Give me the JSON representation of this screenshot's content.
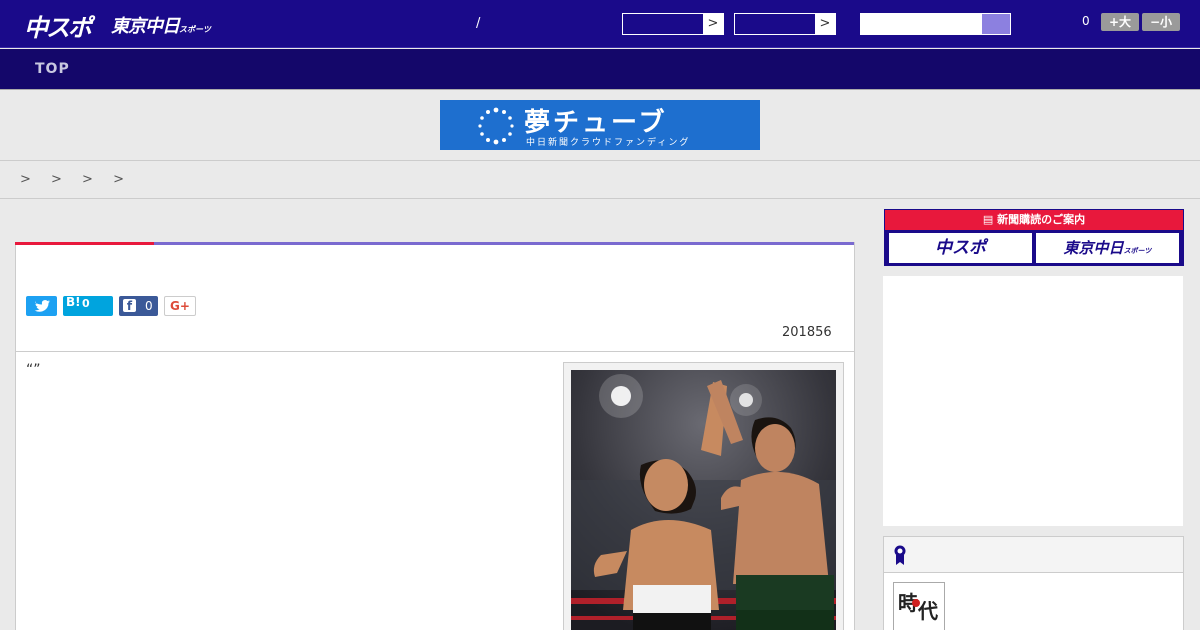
{
  "header": {
    "logo_main": "中スポ",
    "logo_sub": "東京中日",
    "logo_sub_small": "スポーツ",
    "date_separator": "/",
    "font_size_value": "0",
    "font_larger_label": "+大",
    "font_smaller_label": "−小",
    "select_arrow": ">"
  },
  "nav": {
    "items": [
      "TOP"
    ]
  },
  "banner": {
    "title": "夢チューブ",
    "subtitle": "中日新聞クラウドファンディング"
  },
  "breadcrumb": {
    "separators": "> > > >"
  },
  "article": {
    "share": {
      "hatena_label": "B!",
      "hatena_count": "0",
      "facebook_count": "0",
      "gplus_label": "G+"
    },
    "date": "201856",
    "quote": "“”"
  },
  "sidebar": {
    "subscription_heading": "新聞購読のご案内",
    "subscription_buttons": [
      "中スポ",
      "東京中日"
    ],
    "subscription_small": "スポーツ",
    "ranking_thumb_text": [
      "時",
      "代"
    ]
  },
  "colors": {
    "header_bg": "#1a0a8a",
    "nav_bg": "#14076a",
    "accent_red": "#e8183c",
    "accent_purple": "#7a6ad0",
    "twitter": "#1da1f2",
    "hatena": "#00a4de",
    "facebook": "#3b5998",
    "gplus": "#dd4b39"
  }
}
